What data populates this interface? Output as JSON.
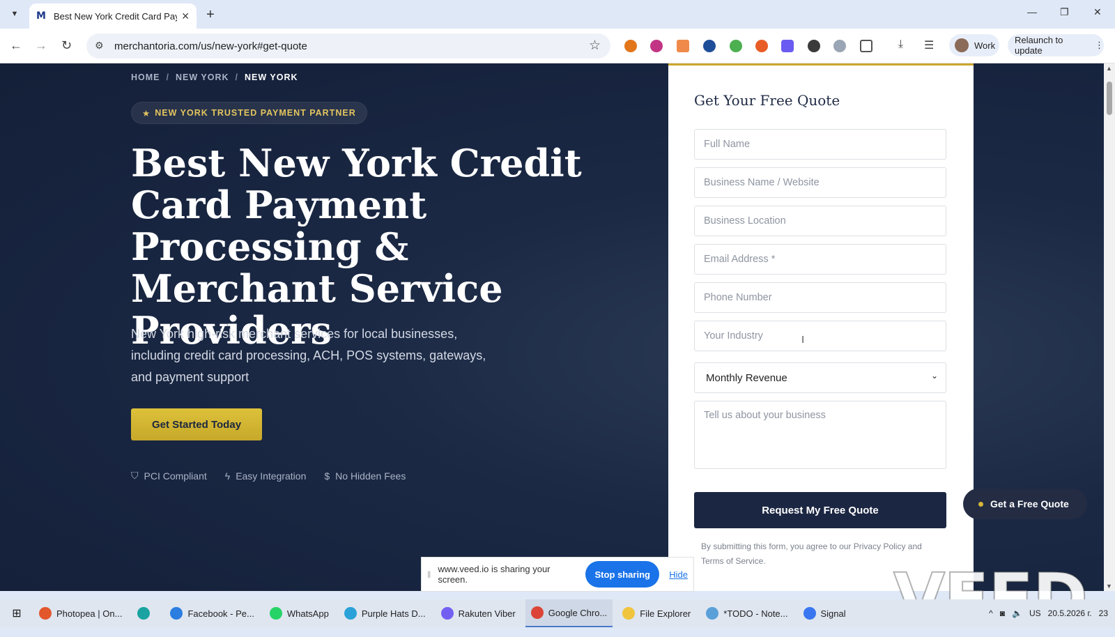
{
  "browser": {
    "tab_title": "Best New York Credit Card Paym",
    "tab_favicon": "M",
    "url": "merchantoria.com/us/new-york#get-quote",
    "profile_label": "Work",
    "relaunch_label": "Relaunch to update"
  },
  "breadcrumb": {
    "items": [
      "HOME",
      "NEW YORK",
      "NEW YORK"
    ],
    "separator": "/"
  },
  "hero": {
    "badge_star": "★",
    "badge": "NEW YORK TRUSTED PAYMENT PARTNER",
    "title": "Best New York Credit Card Payment Processing & Merchant Service Providers",
    "subtitle": "New York high-risk merchant services for local businesses, including credit card processing, ACH, POS systems, gateways, and payment support",
    "cta": "Get Started Today",
    "features": [
      {
        "icon": "shield-icon",
        "label": "PCI Compliant"
      },
      {
        "icon": "lightning-icon",
        "label": "Easy Integration"
      },
      {
        "icon": "dollar-icon",
        "label": "No Hidden Fees"
      }
    ]
  },
  "form": {
    "title": "Get Your Free Quote",
    "full_name": "Full Name",
    "business_name": "Business Name / Website",
    "business_location": "Business Location",
    "email": "Email Address *",
    "phone": "Phone Number",
    "industry": "Your Industry",
    "revenue_selected": "Monthly Revenue",
    "message": "Tell us about your business",
    "submit": "Request My Free Quote",
    "terms": "By submitting this form, you agree to our Privacy Policy and Terms of Service."
  },
  "floating_cta": "Get a Free Quote",
  "screen_share": {
    "message": "www.veed.io is sharing your screen.",
    "stop": "Stop sharing",
    "hide": "Hide"
  },
  "watermark": "VEED",
  "taskbar": {
    "items": [
      {
        "label": "Photopea | On...",
        "color": "#e2572c"
      },
      {
        "label": "",
        "color": "#1aa3a0"
      },
      {
        "label": "Facebook - Pe...",
        "color": "#2b7de0"
      },
      {
        "label": "WhatsApp",
        "color": "#25d366"
      },
      {
        "label": "Purple Hats D...",
        "color": "#2aa1d8"
      },
      {
        "label": "Rakuten Viber",
        "color": "#7360f2"
      },
      {
        "label": "Google Chro...",
        "color": "#db4437"
      },
      {
        "label": "File Explorer",
        "color": "#f0c43c"
      },
      {
        "label": "*TODO - Note...",
        "color": "#5aa0d8"
      },
      {
        "label": "Signal",
        "color": "#3a76f0"
      }
    ],
    "language": "US",
    "date": "20.5.2026 г.",
    "notifications": "23"
  },
  "colors": {
    "accent_gold": "#d4b536",
    "navy": "#1b2642",
    "page_bg": "#1b2945"
  }
}
